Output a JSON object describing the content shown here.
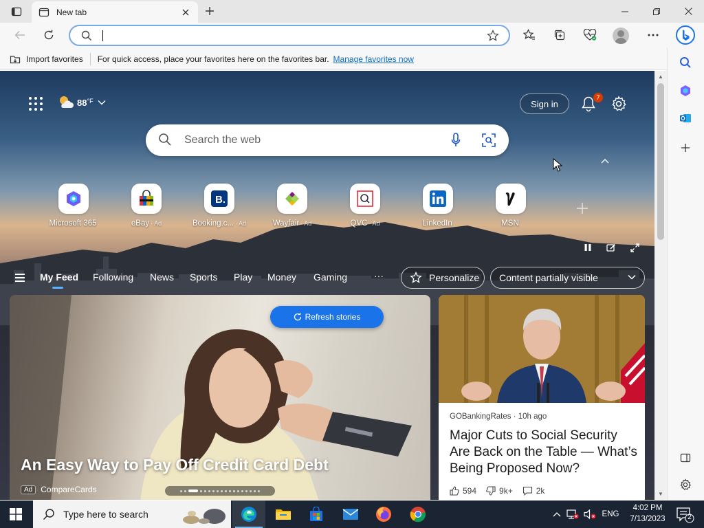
{
  "window": {
    "tab_title": "New tab"
  },
  "toolbar": {
    "address_value": ""
  },
  "favorites_bar": {
    "import_label": "Import favorites",
    "message": "For quick access, place your favorites here on the favorites bar.",
    "manage_link": "Manage favorites now"
  },
  "newtab": {
    "weather": {
      "temp": "88",
      "unit": "°F"
    },
    "signin_label": "Sign in",
    "notification_count": "7",
    "search_placeholder": "Search the web",
    "quick_links": [
      {
        "label": "Microsoft 365",
        "ad": "",
        "icon": "microsoft-365-icon"
      },
      {
        "label": "eBay",
        "ad": "· Ad",
        "icon": "ebay-icon"
      },
      {
        "label": "Booking.c...",
        "ad": "· Ad",
        "icon": "booking-icon"
      },
      {
        "label": "Wayfair",
        "ad": "· Ad",
        "icon": "wayfair-icon"
      },
      {
        "label": "QVC",
        "ad": "· Ad",
        "icon": "qvc-icon"
      },
      {
        "label": "LinkedIn",
        "ad": "",
        "icon": "linkedin-icon"
      },
      {
        "label": "MSN",
        "ad": "",
        "icon": "msn-icon"
      }
    ],
    "feed_nav": {
      "items": [
        "My Feed",
        "Following",
        "News",
        "Sports",
        "Play",
        "Money",
        "Gaming"
      ],
      "more": "···",
      "personalize": "Personalize",
      "visibility": "Content partially visible"
    },
    "refresh_label": "Refresh stories",
    "main_card": {
      "title": "An Easy Way to Pay Off Credit Card Debt",
      "ad_tag": "Ad",
      "advertiser": "CompareCards"
    },
    "side_card": {
      "source": "GOBankingRates · 10h ago",
      "headline": "Major Cuts to Social Security Are Back on the Table — What’s Being Proposed Now?",
      "likes": "594",
      "dislikes": "9k+",
      "comments": "2k"
    }
  },
  "taskbar": {
    "search_placeholder": "Type here to search",
    "language": "ENG",
    "time": "4:02 PM",
    "date": "7/13/2023",
    "notification_count": "2"
  },
  "colors": {
    "accent": "#0f6cbd",
    "refresh_button": "#1a73e8",
    "badge": "#d83b01",
    "taskbar": "#1b2433"
  }
}
